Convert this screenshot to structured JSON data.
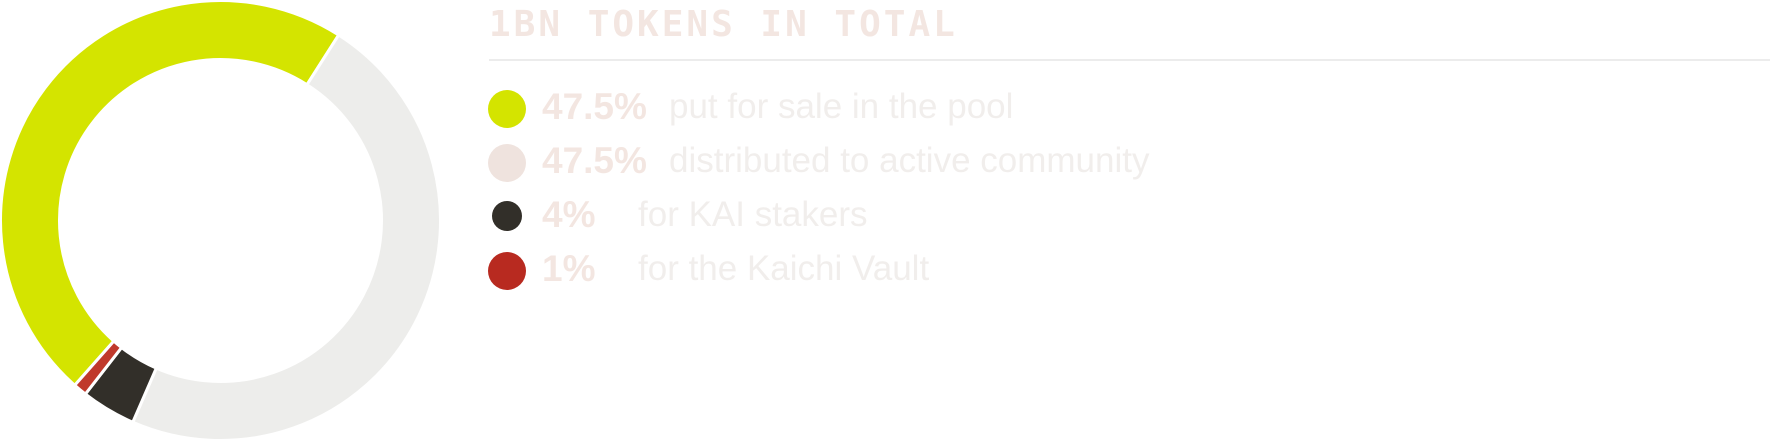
{
  "header": {
    "title": "1BN TOKENS IN TOTAL"
  },
  "legend": [
    {
      "percent": "47.5%",
      "label": "put for sale in the pool",
      "color": "#d4e400"
    },
    {
      "percent": "47.5%",
      "label": "distributed to active community",
      "color": "#efe3de"
    },
    {
      "percent": "4%",
      "label": "for KAI stakers",
      "color": "#322f29"
    },
    {
      "percent": "1%",
      "label": "for the Kaichi Vault",
      "color": "#b82a20"
    }
  ],
  "chart_data": {
    "type": "pie",
    "title": "1BN TOKENS IN TOTAL",
    "variant": "donut",
    "slices": [
      {
        "label": "put for sale in the pool",
        "value": 47.5,
        "color": "#d4e400"
      },
      {
        "label": "distributed to active community",
        "value": 47.5,
        "color": "#ededeb"
      },
      {
        "label": "for KAI stakers",
        "value": 4,
        "color": "#322f29"
      },
      {
        "label": "for the Kaichi Vault",
        "value": 1,
        "color": "#c0392b"
      }
    ],
    "legend_position": "right"
  }
}
